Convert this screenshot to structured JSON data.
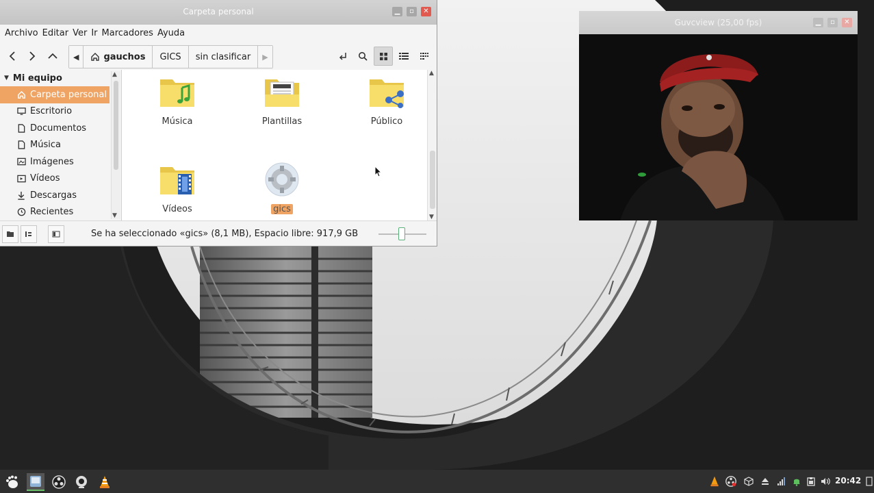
{
  "file_manager": {
    "title": "Carpeta personal",
    "menu": [
      "Archivo",
      "Editar",
      "Ver",
      "Ir",
      "Marcadores",
      "Ayuda"
    ],
    "breadcrumbs": [
      "gauchos",
      "GICS",
      "sin clasificar"
    ],
    "sidebar": {
      "header": "Mi equipo",
      "items": [
        {
          "label": "Carpeta personal",
          "icon": "home-icon",
          "selected": true
        },
        {
          "label": "Escritorio",
          "icon": "desktop-icon"
        },
        {
          "label": "Documentos",
          "icon": "document-icon"
        },
        {
          "label": "Música",
          "icon": "music-icon"
        },
        {
          "label": "Imágenes",
          "icon": "image-icon"
        },
        {
          "label": "Vídeos",
          "icon": "video-icon"
        },
        {
          "label": "Descargas",
          "icon": "download-icon"
        },
        {
          "label": "Recientes",
          "icon": "recent-icon"
        }
      ]
    },
    "files": [
      {
        "label": "Música",
        "icon": "music-folder-icon"
      },
      {
        "label": "Plantillas",
        "icon": "templates-folder-icon"
      },
      {
        "label": "Público",
        "icon": "public-folder-icon"
      },
      {
        "label": "Vídeos",
        "icon": "video-folder-icon"
      },
      {
        "label": "gics",
        "icon": "gear-file-icon",
        "selected": true
      }
    ],
    "status": "Se ha seleccionado «gics» (8,1 MB), Espacio libre: 917,9 GB",
    "accent_color": "#f0a463"
  },
  "webcam": {
    "title": "Guvcview  (25,00 fps)"
  },
  "panel": {
    "clock": "20:42"
  }
}
